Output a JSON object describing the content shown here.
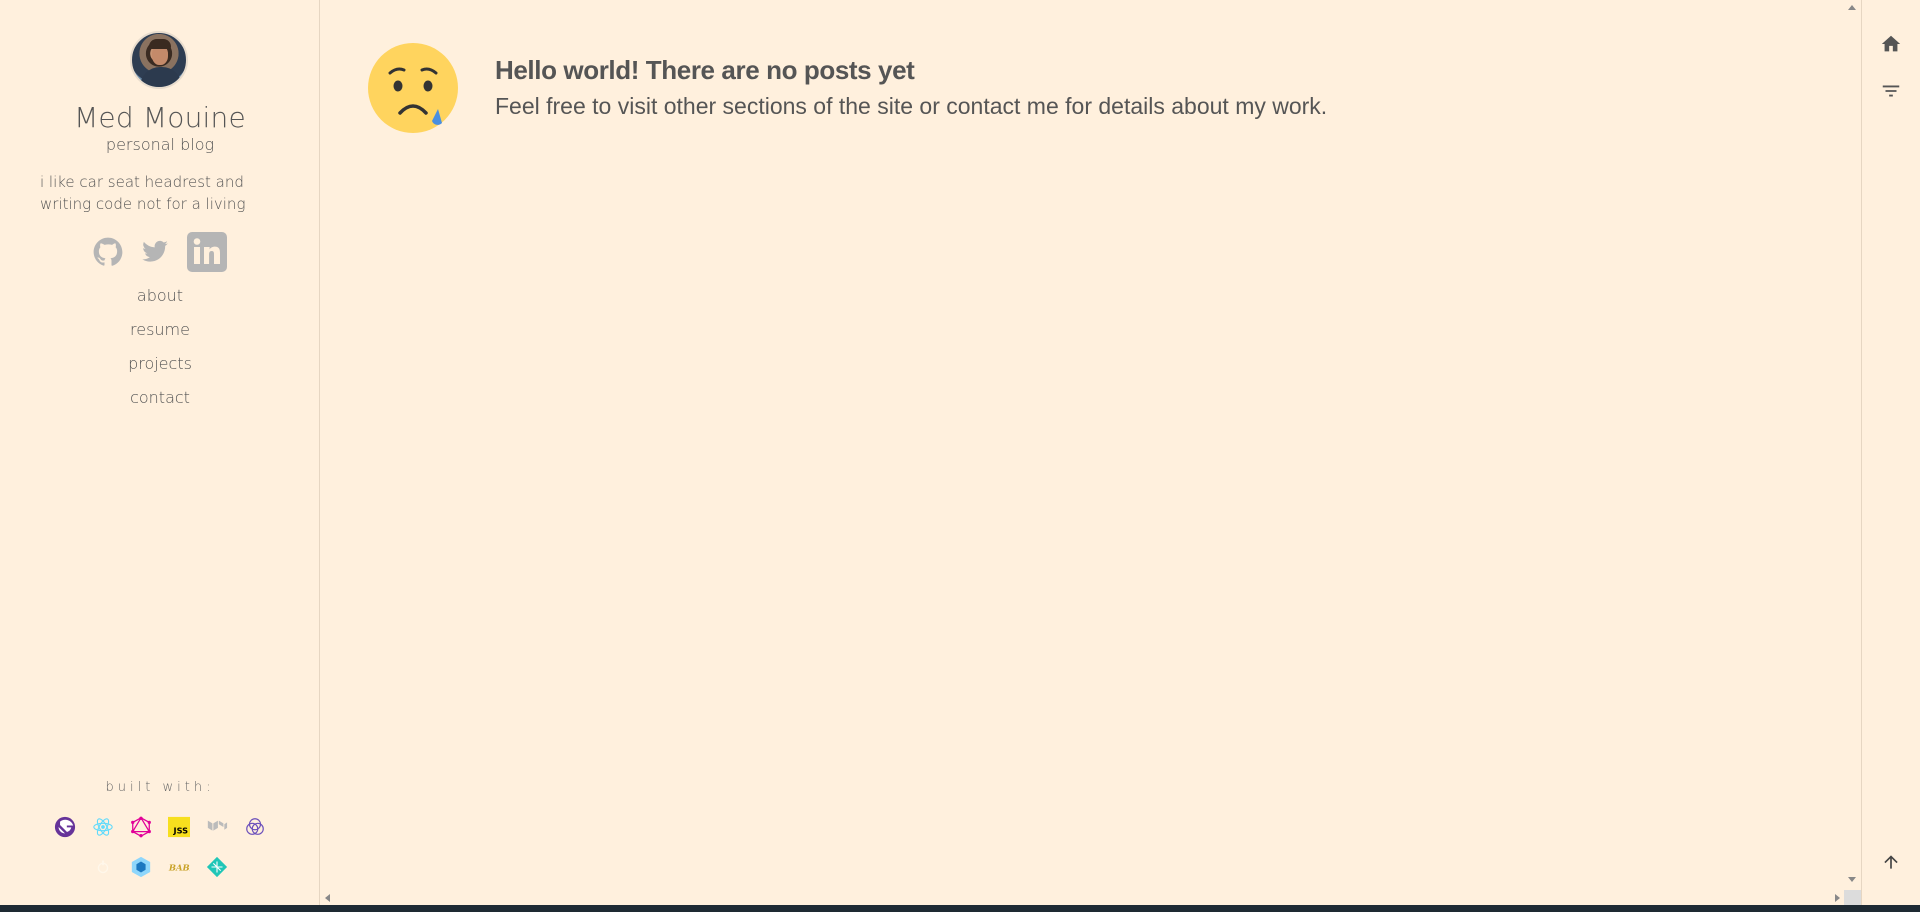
{
  "profile": {
    "name": "Med Mouine",
    "subtitle": "personal blog",
    "bio": "i like car seat headrest and writing code not for a living"
  },
  "socials": [
    {
      "icon": "github-icon"
    },
    {
      "icon": "twitter-icon"
    },
    {
      "icon": "linkedin-icon"
    }
  ],
  "nav": {
    "items": [
      {
        "label": "about"
      },
      {
        "label": "resume"
      },
      {
        "label": "projects"
      },
      {
        "label": "contact"
      }
    ]
  },
  "built_with": {
    "label": "built with:",
    "icons": [
      "gatsby-icon",
      "react-icon",
      "graphql-icon",
      "jss-icon",
      "material-ui-icon",
      "apollo-icon",
      "webpack-icon",
      "babel-icon",
      "netlify-icon",
      "prettier-icon"
    ]
  },
  "main": {
    "emoji": "sad-face-icon",
    "heading": "Hello world! There are no posts yet",
    "message": "Feel free to visit other sections of the site or contact me for details about my work."
  },
  "actionbar": {
    "home": "home-icon",
    "filter": "filter-icon",
    "top": "arrow-up-icon"
  },
  "colors": {
    "background": "#fff0dd",
    "text": "#555555",
    "emoji": "#ffd45e",
    "tear": "#4a8fe0"
  }
}
